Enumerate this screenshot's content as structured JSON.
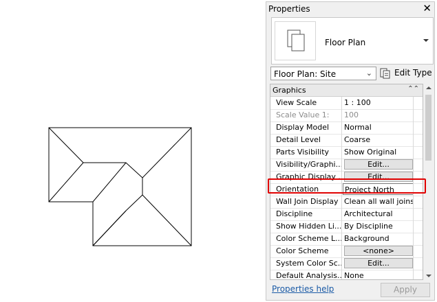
{
  "panel": {
    "title": "Properties",
    "close_glyph": "✕",
    "type_name": "Floor Plan",
    "type_icon": "floor-plan-icon",
    "selector_value": "Floor Plan: Site",
    "edit_type_label": "Edit Type",
    "section_header": "Graphics",
    "rows": [
      {
        "name": "View Scale",
        "value": "1 : 100",
        "kind": "text"
      },
      {
        "name": "Scale Value    1:",
        "value": "100",
        "kind": "disabled"
      },
      {
        "name": "Display Model",
        "value": "Normal",
        "kind": "text"
      },
      {
        "name": "Detail Level",
        "value": "Coarse",
        "kind": "text"
      },
      {
        "name": "Parts Visibility",
        "value": "Show Original",
        "kind": "text"
      },
      {
        "name": "Visibility/Graphi...",
        "value": "Edit...",
        "kind": "button"
      },
      {
        "name": "Graphic Display ...",
        "value": "Edit...",
        "kind": "button"
      },
      {
        "name": "Orientation",
        "value": "Project North",
        "kind": "selected"
      },
      {
        "name": "Wall Join Display",
        "value": "Clean all wall joins",
        "kind": "text"
      },
      {
        "name": "Discipline",
        "value": "Architectural",
        "kind": "text"
      },
      {
        "name": "Show Hidden Li...",
        "value": "By Discipline",
        "kind": "text"
      },
      {
        "name": "Color Scheme L...",
        "value": "Background",
        "kind": "text"
      },
      {
        "name": "Color Scheme",
        "value": "<none>",
        "kind": "button"
      },
      {
        "name": "System Color Sc...",
        "value": "Edit...",
        "kind": "button"
      },
      {
        "name": "Default Analysis...",
        "value": "None",
        "kind": "text"
      }
    ],
    "help_link": "Properties help",
    "apply_label": "Apply",
    "highlight_color": "#e00000"
  }
}
